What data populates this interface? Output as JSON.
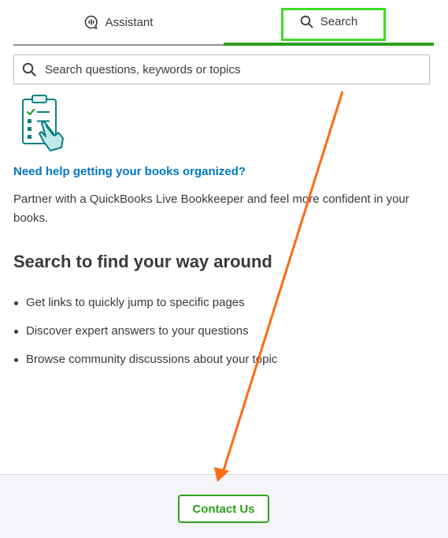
{
  "tabs": [
    {
      "label": "Assistant",
      "icon": "chat-assistant-icon",
      "active": false
    },
    {
      "label": "Search",
      "icon": "search-icon",
      "active": true
    }
  ],
  "search": {
    "placeholder": "Search questions, keywords or topics",
    "value": ""
  },
  "promo": {
    "icon": "clipboard-checklist-icon",
    "link_text": "Need help getting your books organized?",
    "body": "Partner with a QuickBooks Live Bookkeeper and feel more confident in your books."
  },
  "section": {
    "title": "Search to find your way around",
    "bullets": [
      "Get links to quickly jump to specific pages",
      "Discover expert answers to your questions",
      "Browse community discussions about your topic"
    ]
  },
  "footer": {
    "contact_label": "Contact Us"
  },
  "colors": {
    "brand_green": "#2ca01c",
    "link_blue": "#0077c5",
    "text": "#393a3d",
    "annotation_highlight": "#3ddc22",
    "annotation_arrow": "#ff6a13"
  }
}
